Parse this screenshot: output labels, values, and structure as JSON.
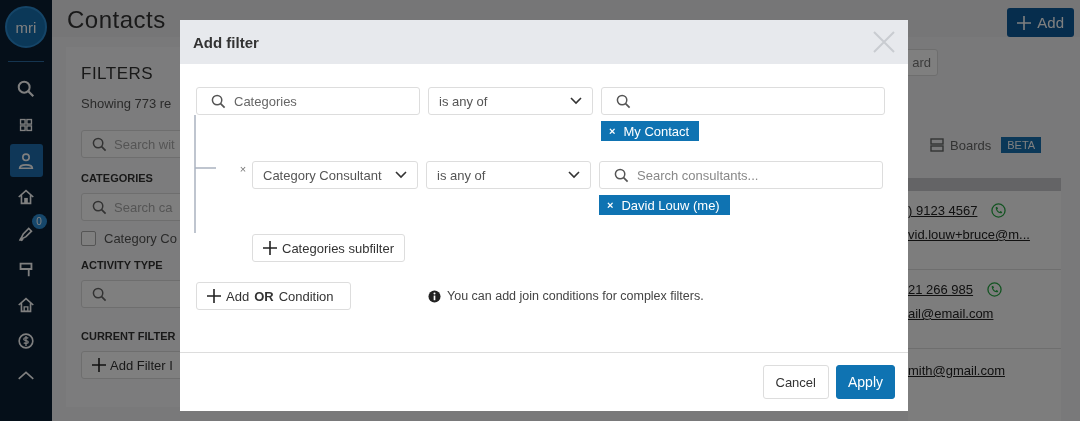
{
  "sidebar": {
    "logo": "mri",
    "items": [
      {
        "selected": false
      },
      {
        "selected": false
      },
      {
        "selected": true
      },
      {
        "selected": false
      },
      {
        "selected": false,
        "badge": "0"
      },
      {
        "selected": false
      },
      {
        "selected": false
      },
      {
        "selected": false
      },
      {
        "selected": false
      }
    ]
  },
  "header": {
    "title": "Contacts",
    "add_button": "Add"
  },
  "filters_panel": {
    "title": "FILTERS",
    "summary": "Showing 773 re",
    "search_placeholder": "Search wit",
    "categories_heading": "CATEGORIES",
    "categories_placeholder": "Search ca",
    "checkbox": {
      "label": "Category Co",
      "checked": false
    },
    "activity_heading": "ACTIVITY TYPE",
    "current_filter_heading": "CURRENT FILTER",
    "add_filter_button": "Add Filter I"
  },
  "results": {
    "view_button": "ard",
    "boards_label": "Boards",
    "beta_badge": "BETA",
    "rows": [
      {
        "phone": ") 9123 4567",
        "email": "vid.louw+bruce@m..."
      },
      {
        "phone": "21 266 985",
        "email": "ail@email.com"
      },
      {
        "email": "mith@gmail.com"
      }
    ]
  },
  "dialog": {
    "title": "Add filter",
    "condition": {
      "field": "Categories",
      "operator": "is any of",
      "chips": [
        "My Contact"
      ],
      "chip_remove": "×"
    },
    "subfilter": {
      "remove": "×",
      "field": "Category Consultant",
      "operator": "is any of",
      "value_placeholder": "Search consultants...",
      "chips": [
        "David Louw (me)"
      ],
      "chip_remove": "×"
    },
    "subfilter_button": "Categories subfilter",
    "or_button": "Add **OR** Condition",
    "info": "You can add join conditions for complex filters.",
    "cancel_button": "Cancel",
    "apply_button": "Apply"
  }
}
